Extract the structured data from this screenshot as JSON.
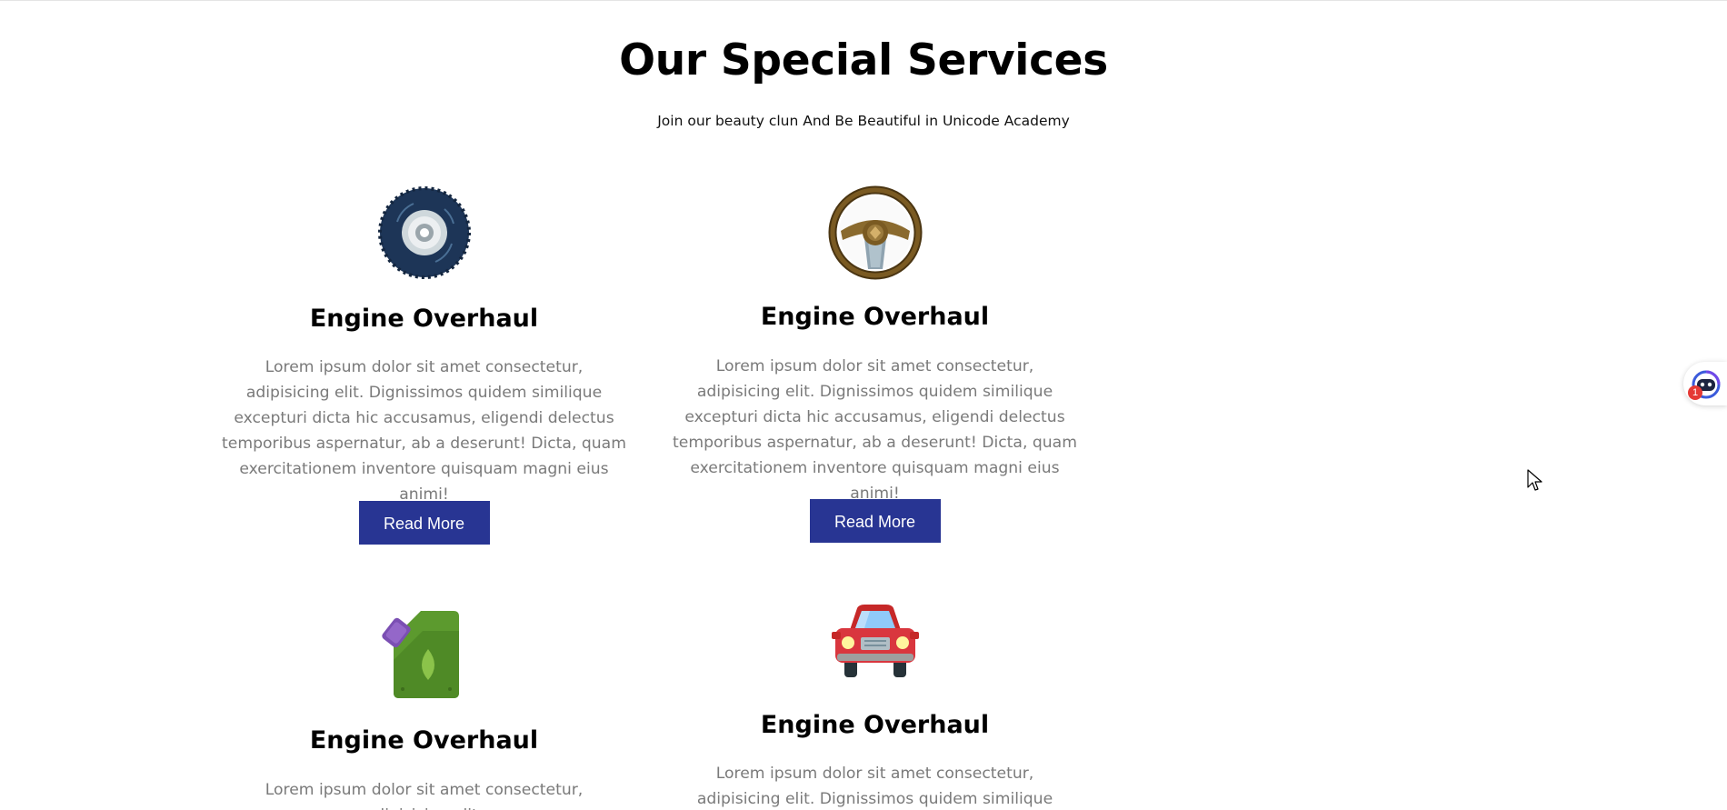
{
  "section": {
    "title": "Our Special Services",
    "subtitle": "Join our beauty clun And Be Beautiful in Unicode Academy"
  },
  "cards": [
    {
      "icon": "tire-icon",
      "title": "Engine Overhaul",
      "text": "Lorem ipsum dolor sit amet consectetur, adipisicing elit. Dignissimos quidem similique excepturi dicta hic accusamus, eligendi delectus temporibus aspernatur, ab a deserunt! Dicta, quam exercitationem inventore quisquam magni eius animi!",
      "button_label": "Read More"
    },
    {
      "icon": "steering-wheel-icon",
      "title": "Engine Overhaul",
      "text": "Lorem ipsum dolor sit amet consectetur, adipisicing elit. Dignissimos quidem similique excepturi dicta hic accusamus, eligendi delectus temporibus aspernatur, ab a deserunt! Dicta, quam exercitationem inventore quisquam magni eius animi!",
      "button_label": "Read More"
    },
    {
      "icon": "oil-canister-icon",
      "title": "Engine Overhaul",
      "text": "Lorem ipsum dolor sit amet consectetur, adipisicing elit."
    },
    {
      "icon": "car-icon",
      "title": "Engine Overhaul",
      "text": "Lorem ipsum dolor sit amet consectetur, adipisicing elit. Dignissimos quidem similique excepturi dicta hic"
    }
  ],
  "floating_widget": {
    "icon": "assistant-face-icon",
    "badge_count": "1"
  },
  "colors": {
    "button_bg": "#283593",
    "body_text": "#7a7a7a",
    "tire_dark": "#1d3557",
    "wheel_brown": "#6b4f1d",
    "canister_green": "#5c9a2e",
    "canister_purple": "#7b4fb3",
    "car_red": "#d9363e"
  }
}
